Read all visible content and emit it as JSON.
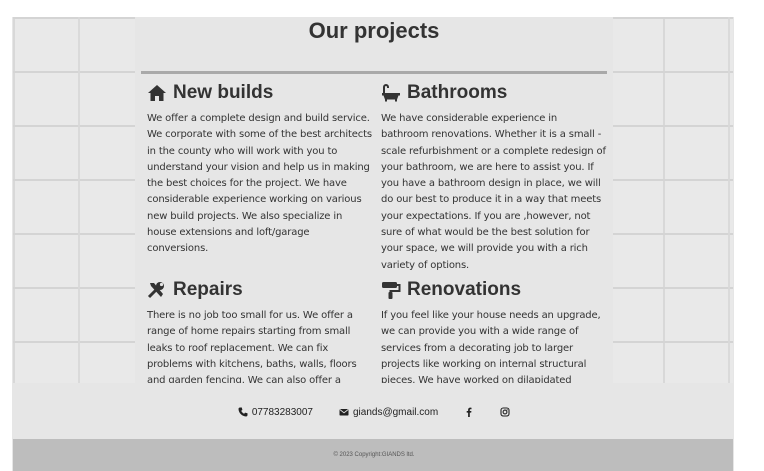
{
  "section": {
    "title": "Our projects"
  },
  "projects": [
    {
      "title": "New builds",
      "icon": "home-icon",
      "text": "We offer a complete design and build service. We corporate with some of the best architects in the county who will work with you to understand your vision and help us in making the best choices for the project. We have considerable experience working on various new build projects. We also specialize in house extensions and loft/garage conversions."
    },
    {
      "title": "Bathrooms",
      "icon": "bath-icon",
      "text": "We have considerable experience in bathroom renovations. Whether it is a small -scale refurbishment or a complete redesign of your bathroom, we are here to assist you. If you have a bathroom design in place, we will do our best to produce it in a way that meets your expectations. If you are ,however, not sure of what would be the best solution for your space, we will provide you with a rich variety of options."
    },
    {
      "title": "Repairs",
      "icon": "tools-icon",
      "text": "There is no job too small for us. We offer a range of home repairs starting from small leaks to roof replacement. We can fix problems with kitchens, baths, walls, floors and garden fencing. We can also offer a discount if you"
    },
    {
      "title": "Renovations",
      "icon": "paint-roller-icon",
      "text": "If you feel like your house needs an upgrade, we can provide you with a wide range of services from a decorating job to larger projects like working on internal structural pieces. We have worked on dilapidated houses"
    }
  ],
  "footer": {
    "phone": "07783283007",
    "email": "giands@gmail.com",
    "copyright": "© 2023 Copyright:GIANDS ltd."
  }
}
